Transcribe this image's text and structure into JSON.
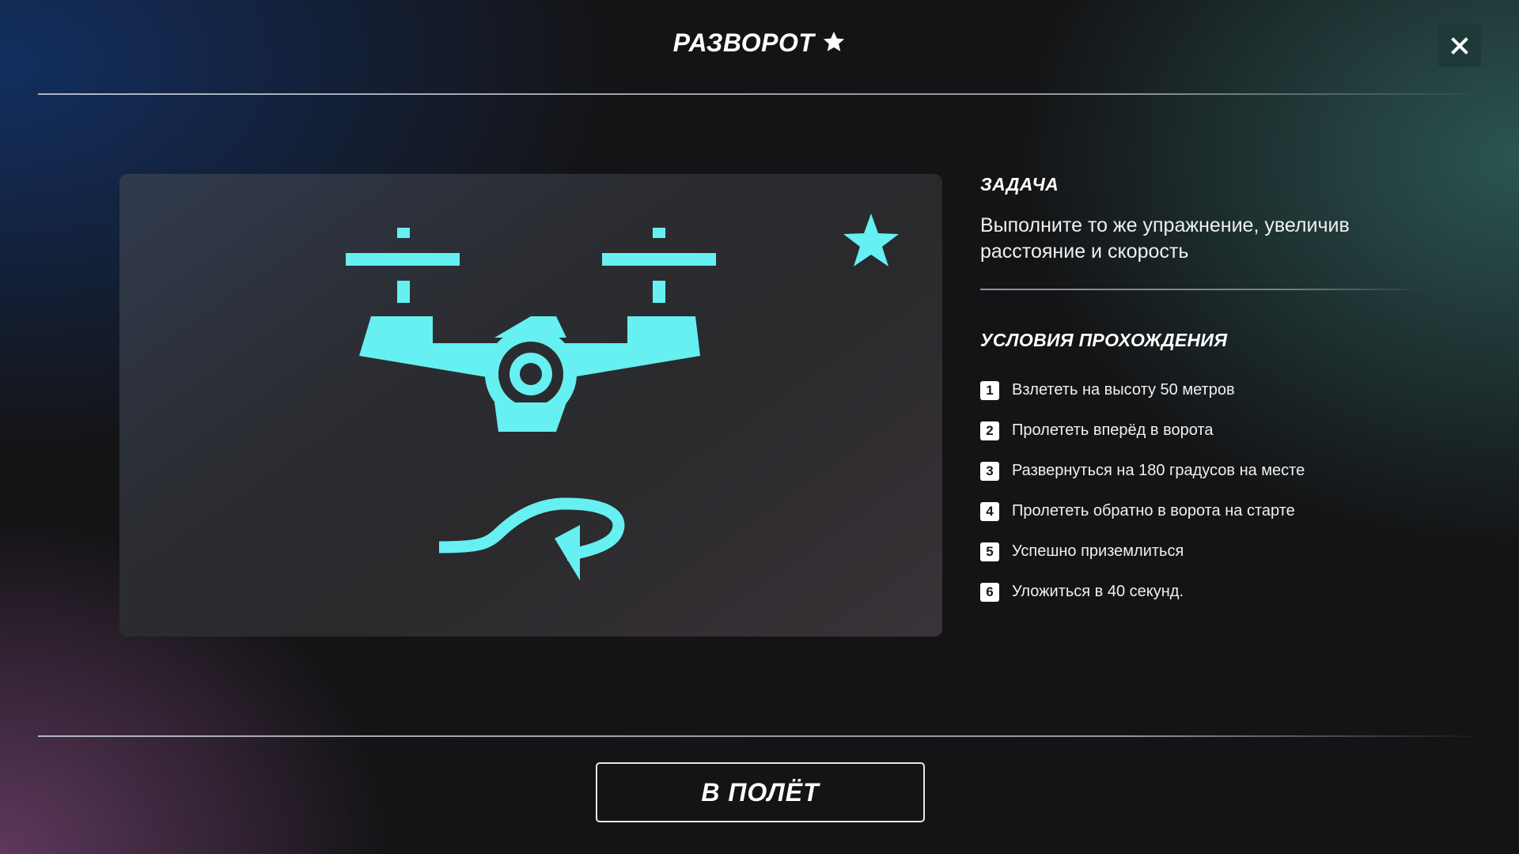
{
  "header": {
    "title": "РАЗВОРОТ",
    "star_icon": "star-icon",
    "close_icon": "close-icon"
  },
  "illustration": {
    "icons": [
      "drone-icon",
      "u-turn-arrow-icon",
      "star-icon"
    ],
    "accent_color": "#66f0f2"
  },
  "task": {
    "heading": "ЗАДАЧА",
    "text": "Выполните то же упражнение, увеличив расстояние и скорость"
  },
  "conditions": {
    "heading": "УСЛОВИЯ ПРОХОЖДЕНИЯ",
    "items": [
      {
        "num": "1",
        "text": "Взлететь на высоту 50 метров"
      },
      {
        "num": "2",
        "text": "Пролететь вперёд в ворота"
      },
      {
        "num": "3",
        "text": "Развернуться на 180 градусов на месте"
      },
      {
        "num": "4",
        "text": "Пролететь обратно в ворота на старте"
      },
      {
        "num": "5",
        "text": "Успешно приземлиться"
      },
      {
        "num": "6",
        "text": "Уложиться в 40 секунд."
      }
    ]
  },
  "footer": {
    "fly_label": "В ПОЛЁТ"
  }
}
